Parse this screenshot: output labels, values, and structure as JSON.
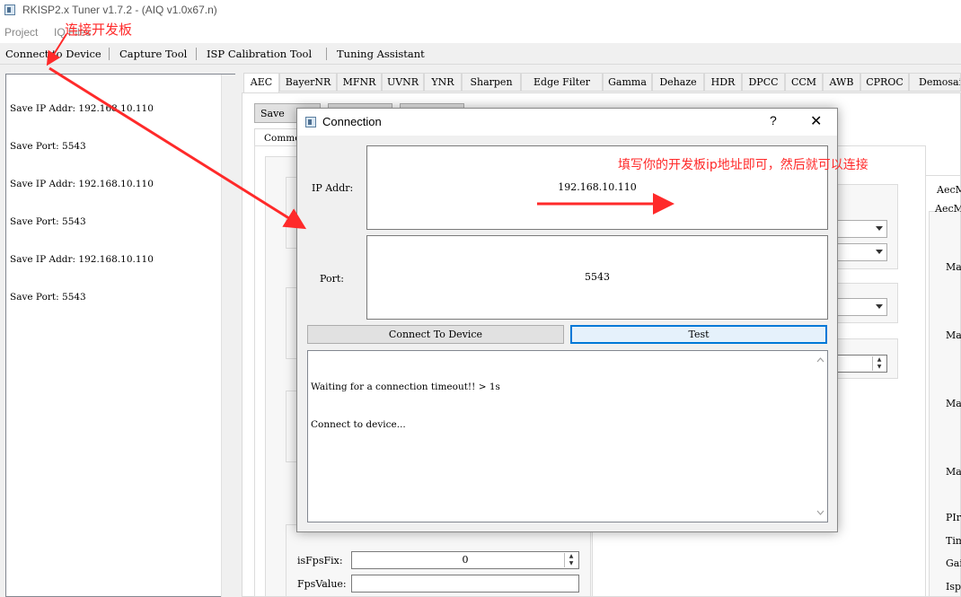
{
  "window": {
    "title": "RKISP2.x Tuner v1.7.2 - (AIQ v1.0x67.n)"
  },
  "menu": [
    "Project",
    "IQ Files"
  ],
  "toolbar": [
    "Connect to Device",
    "Capture Tool",
    "ISP Calibration Tool",
    "Tuning Assistant"
  ],
  "log_panel": {
    "lines": [
      "Save IP Addr: 192.168.10.110",
      "Save Port: 5543",
      "Save IP Addr: 192.168.10.110",
      "Save Port: 5543",
      "Save IP Addr: 192.168.10.110",
      "Save Port: 5543"
    ]
  },
  "tabs": [
    "AEC",
    "BayerNR",
    "MFNR",
    "UVNR",
    "YNR",
    "Sharpen",
    "Edge Filter",
    "Gamma",
    "Dehaze",
    "HDR",
    "DPCC",
    "CCM",
    "AWB",
    "CPROC",
    "Demosaic"
  ],
  "active_tab": "AEC",
  "background": {
    "save_button": "Save",
    "subtab": "Common",
    "fields": [
      {
        "label": "isFpsFix:",
        "value": "0"
      },
      {
        "label": "FpsValue:",
        "value": ""
      }
    ],
    "right_labels": [
      "AecMo",
      "AecMa",
      "Man",
      "Man",
      "Man",
      "Man",
      "PIr",
      "Tim",
      "Gai",
      "Isp"
    ]
  },
  "dialog": {
    "title": "Connection",
    "help": "?",
    "close": "✕",
    "ip_label": "IP Addr:",
    "ip_value": "192.168.10.110",
    "port_label": "Port:",
    "port_value": "5543",
    "connect_button": "Connect To Device",
    "test_button": "Test",
    "log_lines": [
      "Waiting for a connection timeout!! > 1s",
      "Connect to device..."
    ]
  },
  "annotations": {
    "connect_board": "连接开发板",
    "fill_ip": "填写你的开发板ip地址即可，然后就可以连接"
  },
  "colors": {
    "annotation": "#ff2a2a",
    "focus": "#0078d7"
  }
}
